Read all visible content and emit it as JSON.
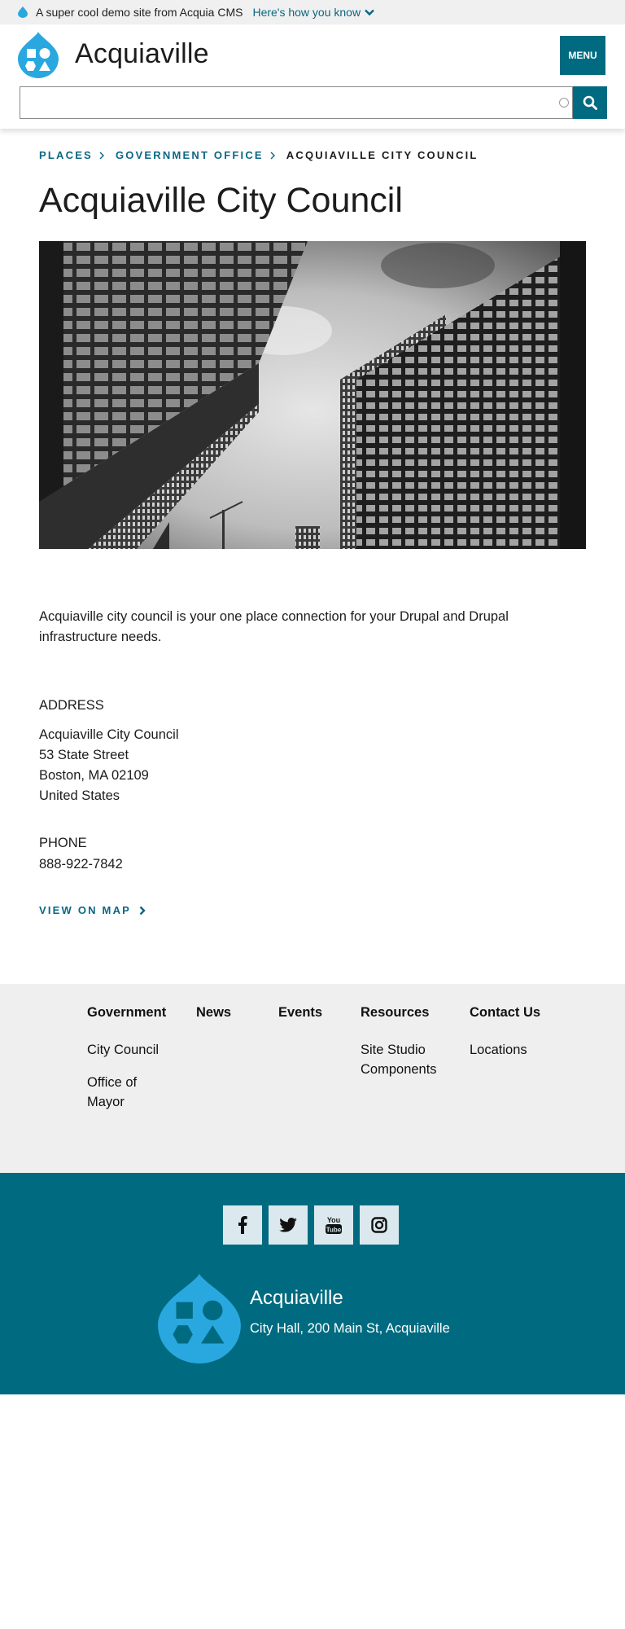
{
  "banner": {
    "message": "A super cool demo site from Acquia CMS",
    "link": "Here's how you know"
  },
  "header": {
    "site_name": "Acquiaville",
    "menu_label": "MENU",
    "search_placeholder": ""
  },
  "breadcrumb": [
    {
      "label": "PLACES"
    },
    {
      "label": "GOVERNMENT OFFICE"
    },
    {
      "label": "ACQUIAVILLE CITY COUNCIL"
    }
  ],
  "page": {
    "title": "Acquiaville City Council",
    "intro": "Acquiaville city council is your one place connection for your Drupal and Drupal infrastructure needs.",
    "address_label": "ADDRESS",
    "address_lines": [
      "Acquiaville City Council",
      "53 State Street",
      "Boston, MA 02109",
      "United States"
    ],
    "phone_label": "PHONE",
    "phone": "888-922-7842",
    "map_link": "VIEW ON MAP"
  },
  "footer_nav": [
    {
      "heading": "Government",
      "items": [
        "City Council",
        "Office of Mayor"
      ]
    },
    {
      "heading": "News",
      "items": []
    },
    {
      "heading": "Events",
      "items": []
    },
    {
      "heading": "Resources",
      "items": [
        "Site Studio Components"
      ]
    },
    {
      "heading": "Contact Us",
      "items": [
        "Locations"
      ]
    }
  ],
  "footer": {
    "social_icons": [
      "facebook-icon",
      "twitter-icon",
      "youtube-icon",
      "instagram-icon"
    ],
    "youtube_text": "You Tube",
    "name": "Acquiaville",
    "address": "City Hall, 200 Main St, Acquiaville"
  },
  "colors": {
    "primary": "#006b80",
    "link": "#0b6782",
    "logo_blue": "#29a8e0",
    "banner_bg": "#f0f0f0",
    "footer_nav_bg": "#efefef"
  }
}
